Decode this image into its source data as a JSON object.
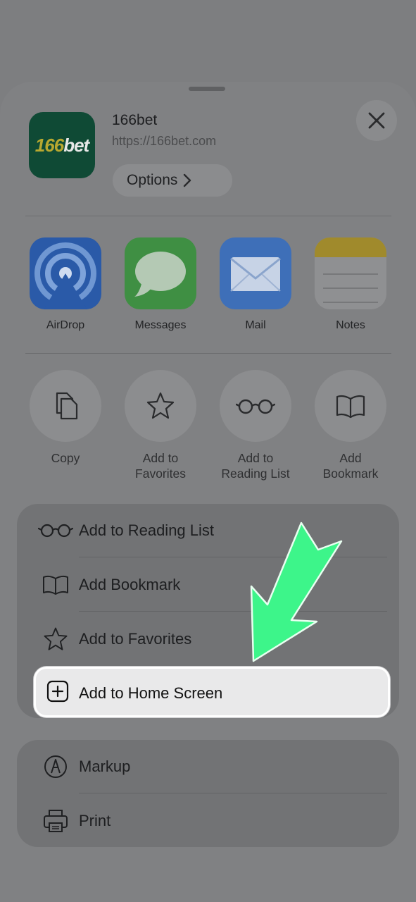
{
  "site": {
    "title": "166bet",
    "url": "https://166bet.com",
    "icon_text_a": "166",
    "icon_text_b": "bet",
    "options_label": "Options"
  },
  "share_apps": [
    {
      "label": "AirDrop",
      "icon": "airdrop-icon"
    },
    {
      "label": "Messages",
      "icon": "messages-icon"
    },
    {
      "label": "Mail",
      "icon": "mail-icon"
    },
    {
      "label": "Notes",
      "icon": "notes-icon"
    }
  ],
  "actions": [
    {
      "label": "Copy",
      "icon": "copy-icon"
    },
    {
      "label": "Add to Favorites",
      "icon": "star-icon"
    },
    {
      "label": "Add to Reading List",
      "icon": "glasses-icon"
    },
    {
      "label": "Add Bookmark",
      "icon": "book-icon"
    }
  ],
  "menu_group_1": [
    {
      "label": "Add to Reading List",
      "icon": "glasses-icon"
    },
    {
      "label": "Add Bookmark",
      "icon": "book-icon"
    },
    {
      "label": "Add to Favorites",
      "icon": "star-icon"
    },
    {
      "label": "Add to Home Screen",
      "icon": "plus-square-icon",
      "highlighted": true
    }
  ],
  "menu_group_2": [
    {
      "label": "Markup",
      "icon": "markup-icon"
    },
    {
      "label": "Print",
      "icon": "printer-icon"
    }
  ],
  "colors": {
    "highlight_arrow": "#3df58a",
    "app_icon_bg": "#0f4a35"
  }
}
